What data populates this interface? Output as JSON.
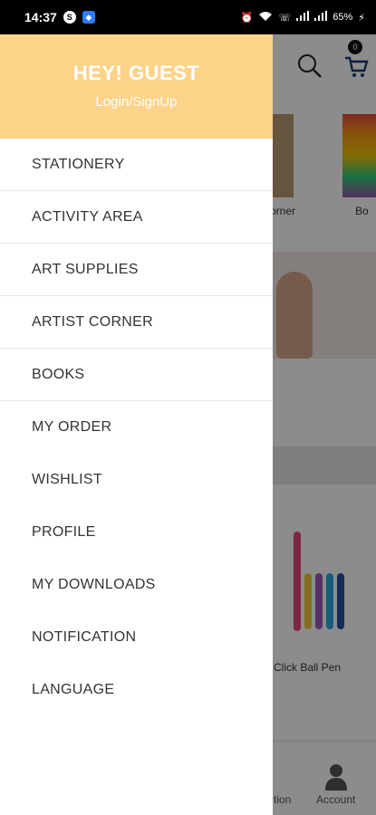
{
  "status_bar": {
    "time": "14:37",
    "battery": "65%"
  },
  "background_app": {
    "cart_count": "0",
    "category_label_1": "orner",
    "category_label_2": "Bo",
    "product_label": "Click Ball Pen",
    "nav_label_1": "tion",
    "nav_label_2": "Account"
  },
  "drawer": {
    "greeting": "HEY! GUEST",
    "login_link": "Login/SignUp",
    "items": [
      {
        "label": "STATIONERY"
      },
      {
        "label": "ACTIVITY AREA"
      },
      {
        "label": "ART SUPPLIES"
      },
      {
        "label": "ARTIST CORNER"
      },
      {
        "label": "BOOKS"
      },
      {
        "label": "MY ORDER"
      },
      {
        "label": "WISHLIST"
      },
      {
        "label": "PROFILE"
      },
      {
        "label": "MY DOWNLOADS"
      },
      {
        "label": "NOTIFICATION"
      },
      {
        "label": "LANGUAGE"
      }
    ]
  },
  "colors": {
    "drawer_header": "#fdd38a",
    "scrim": "rgba(0,0,0,0.45)"
  }
}
